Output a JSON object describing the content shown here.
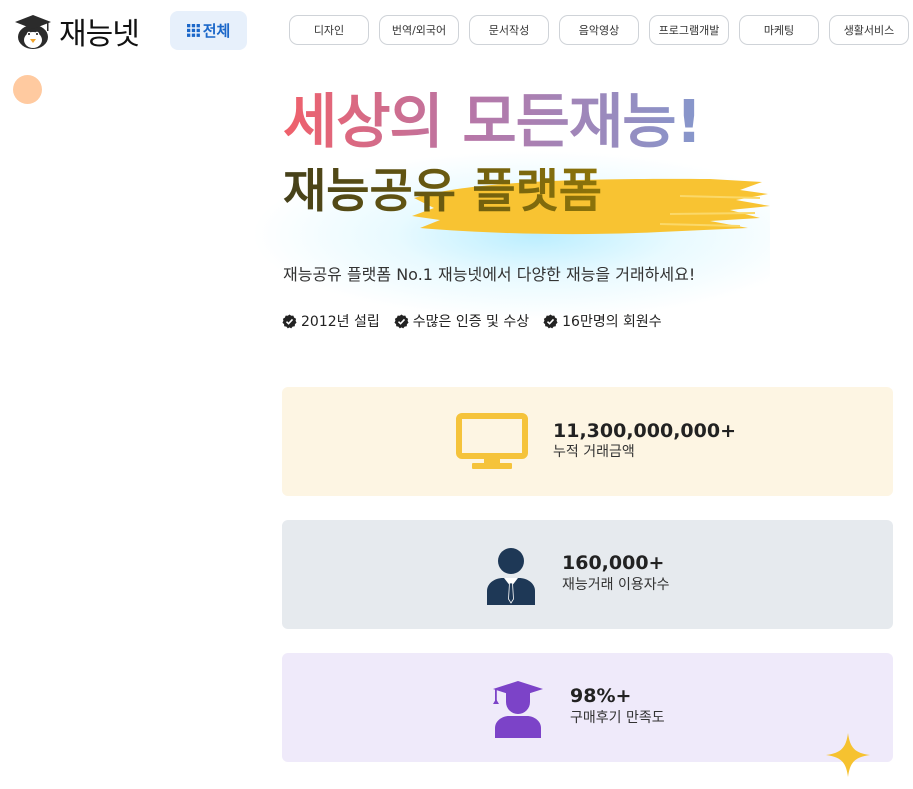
{
  "brand": {
    "name": "재능넷",
    "icon": "penguin-graduate-icon"
  },
  "nav": {
    "all_label": "전체",
    "all_icon": "grid-icon",
    "categories": [
      "디자인",
      "번역/외국어",
      "문서작성",
      "음악영상",
      "프로그램개발",
      "마케팅",
      "생활서비스"
    ]
  },
  "hero": {
    "headline_1": "세상의 모든재능!",
    "headline_2": "재능공유 플랫폼",
    "subtext": "재능공유 플랫폼 No.1 재능넷에서 다양한 재능을 거래하세요!",
    "badges": [
      "2012년 설립",
      "수많은 인증 및 수상",
      "16만명의 회원수"
    ]
  },
  "stats": [
    {
      "value": "11,300,000,000+",
      "label": "누적 거래금액",
      "icon": "monitor-icon",
      "bg": "#fdf5e3"
    },
    {
      "value": "160,000+",
      "label": "재능거래 이용자수",
      "icon": "user-suit-icon",
      "bg": "#e6eaee"
    },
    {
      "value": "98%+",
      "label": "구매후기 만족도",
      "icon": "graduate-user-icon",
      "bg": "#efeafa"
    }
  ],
  "colors": {
    "accent_blue": "#1b67c9",
    "brush_yellow": "#f8c332",
    "monitor_yellow": "#f5c33b",
    "user_navy": "#1e3856",
    "graduate_purple": "#7c43c8"
  }
}
